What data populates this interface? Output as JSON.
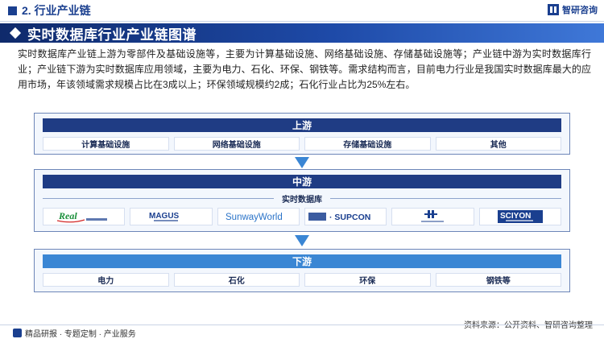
{
  "header": {
    "section": "2. 行业产业链",
    "brand": "智研咨询"
  },
  "title": "实时数据库行业产业链图谱",
  "paragraph": "实时数据库产业链上游为零部件及基础设施等，主要为计算基础设施、网络基础设施、存储基础设施等；产业链中游为实时数据库行业；产业链下游为实时数据库应用领域，主要为电力、石化、环保、钢铁等。需求结构而言，目前电力行业是我国实时数据库最大的应用市场，年该领域需求规模占比在3成以上；环保领域规模约2成；石化行业占比为25%左右。",
  "upstream": {
    "label": "上游",
    "items": [
      "计算基础设施",
      "网络基础设施",
      "存储基础设施",
      "其他"
    ]
  },
  "midstream": {
    "label": "中游",
    "sub_label": "实时数据库",
    "logos": [
      "Real 紫金桥软件",
      "MAGUS 麦杰科技",
      "SunwayWorld",
      "中控·SUPCON",
      "中国南方电网",
      "SCIYON 科远智慧"
    ]
  },
  "downstream": {
    "label": "下游",
    "items": [
      "电力",
      "石化",
      "环保",
      "钢铁等"
    ]
  },
  "footer": {
    "left": "精品研报 · 专题定制 · 产业服务",
    "source": "资料来源：公开资料、智研咨询整理"
  },
  "colors": {
    "primary": "#1f3c84",
    "accent": "#3a86d4"
  }
}
